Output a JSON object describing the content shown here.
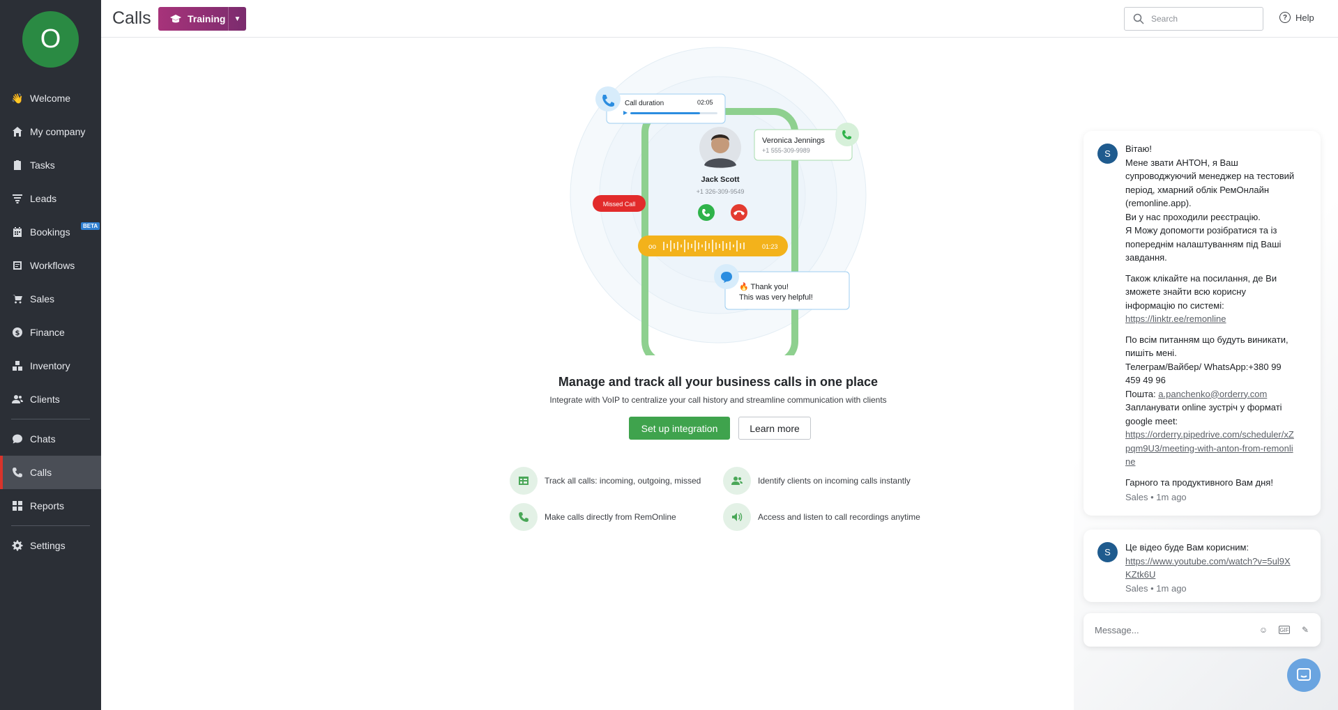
{
  "sidebar": {
    "avatar_letter": "O",
    "items": [
      {
        "label": "Welcome",
        "icon": "wave-hand-icon"
      },
      {
        "label": "My company",
        "icon": "home-icon"
      },
      {
        "label": "Tasks",
        "icon": "clipboard-icon"
      },
      {
        "label": "Leads",
        "icon": "funnel-icon"
      },
      {
        "label": "Bookings",
        "icon": "calendar-icon",
        "badge": "BETA"
      },
      {
        "label": "Workflows",
        "icon": "workflow-icon"
      },
      {
        "label": "Sales",
        "icon": "cart-icon"
      },
      {
        "label": "Finance",
        "icon": "dollar-icon"
      },
      {
        "label": "Inventory",
        "icon": "boxes-icon"
      },
      {
        "label": "Clients",
        "icon": "users-icon"
      },
      {
        "label": "Chats",
        "icon": "chat-icon"
      },
      {
        "label": "Calls",
        "icon": "phone-icon",
        "active": true
      },
      {
        "label": "Reports",
        "icon": "reports-icon"
      },
      {
        "label": "Settings",
        "icon": "gear-icon"
      }
    ]
  },
  "header": {
    "title": "Calls",
    "training_label": "Training",
    "search_placeholder": "Search",
    "help_label": "Help"
  },
  "illustration": {
    "call_duration_label": "Call duration",
    "call_duration_time": "02:05",
    "contact_name": "Jack Scott",
    "contact_phone": "+1 326-309-9549",
    "second_contact_name": "Veronica Jennings",
    "second_contact_phone": "+1 555-309-9989",
    "missed_call_label": "Missed Call",
    "voicemail_time": "01:23",
    "thanks_line1": "🔥 Thank you!",
    "thanks_line2": "This was very helpful!"
  },
  "main": {
    "headline": "Manage and track all your business calls in one place",
    "subline": "Integrate with VoIP to centralize your call history and streamline communication with clients",
    "setup_button": "Set up integration",
    "learn_button": "Learn more",
    "features": [
      "Track all calls: incoming, outgoing, missed",
      "Identify clients on incoming calls instantly",
      "Make calls directly from RemOnline",
      "Access and listen to call recordings anytime"
    ]
  },
  "chat": {
    "sender_initial": "S",
    "message1": {
      "para1_lines": [
        "Вітаю!",
        "Мене звати АНТОН, я Ваш супроводжуючий менеджер на тестовий період, хмарний облік РемОнлайн (remonline.app).",
        "Ви у нас проходили реєстрацію.",
        "Я Можу допомогти розібратися та із попереднім налаштуванням під Ваші завдання."
      ],
      "para2_text": "Також клікайте на посилання, де Ви зможете знайти всю корисну інформацію по системі:",
      "para2_link": "https://linktr.ee/remonline",
      "para3_text": "По всім питанням що будуть виникати, пишіть мені.",
      "para3_phone": "Телеграм/Вайбер/ WhatsApp:+380 99 459 49 96",
      "para3_mail_label": "Пошта: ",
      "para3_mail": "a.panchenko@orderry.com",
      "para3_meet_text": "Запланувати online зустріч у форматі google meet:",
      "para3_meet_link": "https://orderry.pipedrive.com/scheduler/xZpqm9U3/meeting-with-anton-from-remonline",
      "para4_text": "Гарного та продуктивного Вам дня!",
      "meta": "Sales • 1m ago"
    },
    "message2": {
      "text": "Це відео буде Вам корисним:",
      "link": "https://www.youtube.com/watch?v=5ul9XKZtk6U",
      "meta": "Sales • 1m ago"
    },
    "composer_placeholder": "Message..."
  },
  "colors": {
    "sidebar_bg": "#2b2f36",
    "avatar_bg": "#2a8a43",
    "active_indicator": "#d9342b",
    "training_gradient_start": "#a7337a",
    "primary_green": "#3fa34d",
    "chat_avatar": "#1f5b8e"
  }
}
